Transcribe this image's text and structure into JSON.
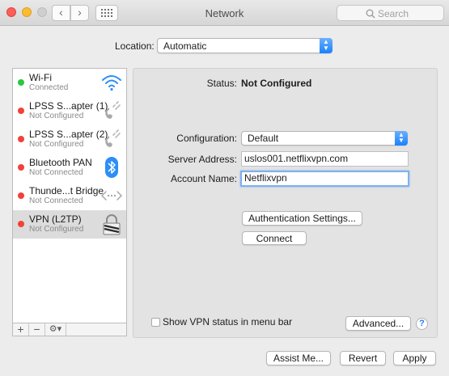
{
  "window": {
    "title": "Network"
  },
  "toolbar": {
    "search_placeholder": "Search",
    "back": "‹",
    "forward": "›"
  },
  "location": {
    "label": "Location:",
    "value": "Automatic"
  },
  "services": [
    {
      "name": "Wi-Fi",
      "status": "Connected",
      "status_color": "#2bc840",
      "icon": "wifi-icon"
    },
    {
      "name": "LPSS S...apter (1)",
      "status": "Not Configured",
      "status_color": "#f24139",
      "icon": "phone-link-icon"
    },
    {
      "name": "LPSS S...apter (2)",
      "status": "Not Configured",
      "status_color": "#f24139",
      "icon": "phone-link-icon"
    },
    {
      "name": "Bluetooth PAN",
      "status": "Not Connected",
      "status_color": "#f24139",
      "icon": "bluetooth-icon"
    },
    {
      "name": "Thunde...t Bridge",
      "status": "Not Connected",
      "status_color": "#f24139",
      "icon": "thunderbolt-bridge-icon"
    },
    {
      "name": "VPN (L2TP)",
      "status": "Not Configured",
      "status_color": "#f24139",
      "icon": "vpn-lock-icon",
      "selected": true
    }
  ],
  "sidebar_footer": {
    "add": "+",
    "remove": "−",
    "action": "⚙▾"
  },
  "detail": {
    "status_label": "Status:",
    "status_value": "Not Configured",
    "configuration_label": "Configuration:",
    "configuration_value": "Default",
    "server_label": "Server Address:",
    "server_value": "uslos001.netflixvpn.com",
    "account_label": "Account Name:",
    "account_value": "Netflixvpn",
    "auth_button": "Authentication Settings...",
    "connect_button": "Connect",
    "show_status_label": "Show VPN status in menu bar",
    "advanced_button": "Advanced...",
    "help": "?"
  },
  "footer": {
    "assist": "Assist Me...",
    "revert": "Revert",
    "apply": "Apply"
  },
  "colors": {
    "accent": "#1a82fb",
    "connected": "#2bc840",
    "not_connected": "#f24139"
  }
}
